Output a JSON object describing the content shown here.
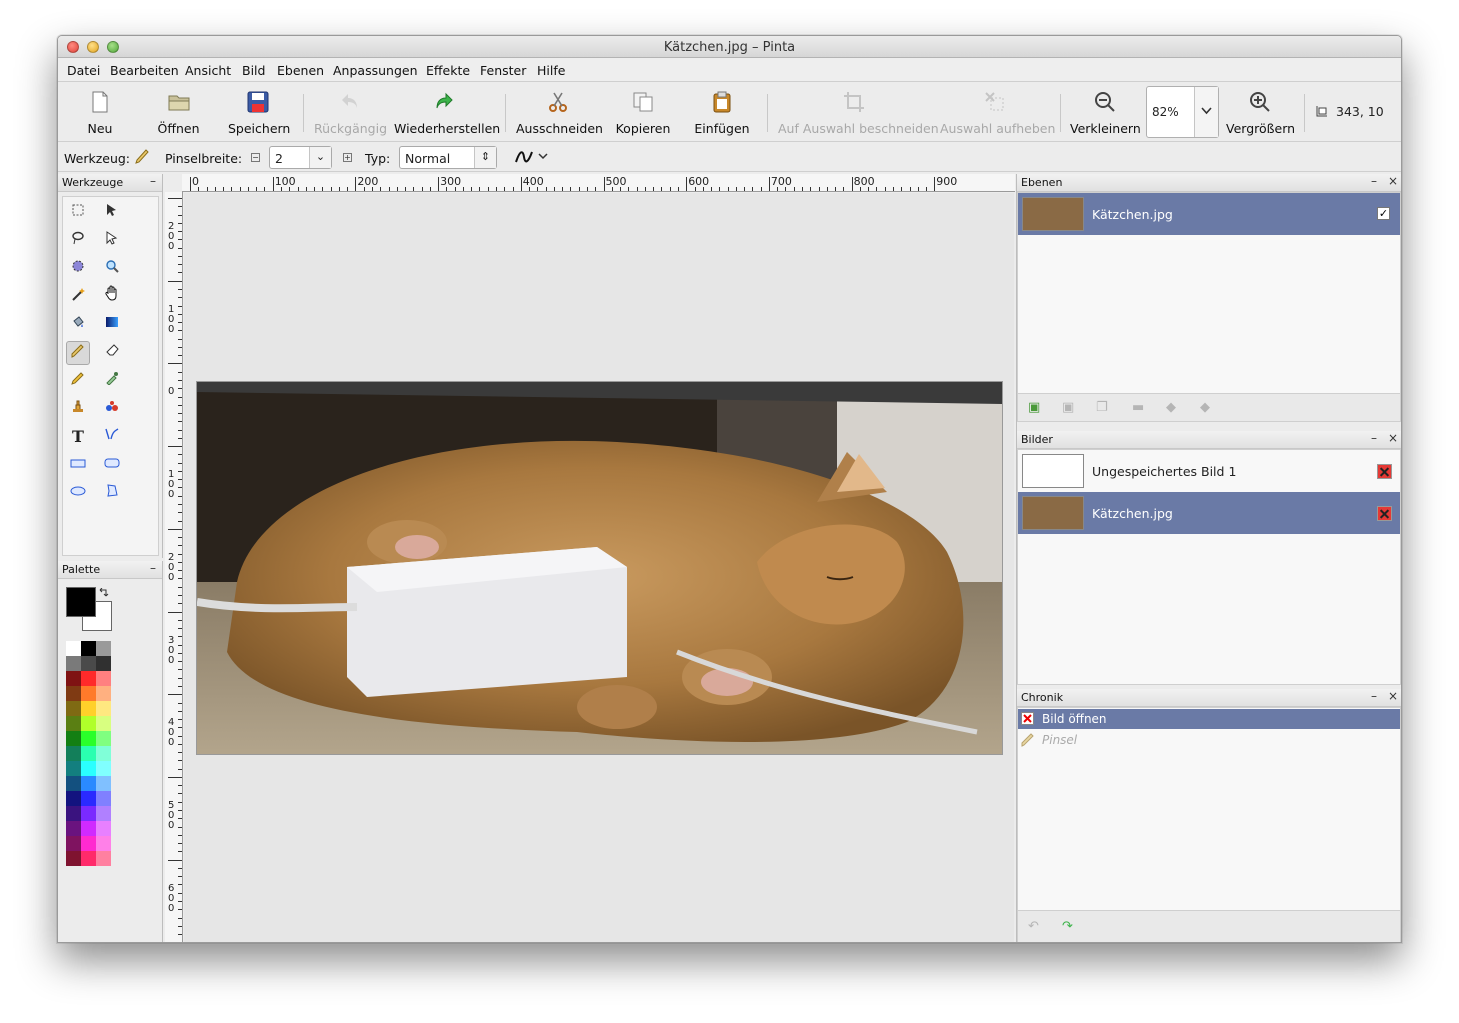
{
  "window": {
    "title": "Kätzchen.jpg – Pinta"
  },
  "menu": [
    "Datei",
    "Bearbeiten",
    "Ansicht",
    "Bild",
    "Ebenen",
    "Anpassungen",
    "Effekte",
    "Fenster",
    "Hilfe"
  ],
  "toolbar": {
    "new": "Neu",
    "open": "Öffnen",
    "save": "Speichern",
    "undo": "Rückgängig",
    "redo": "Wiederherstellen",
    "cut": "Ausschneiden",
    "copy": "Kopieren",
    "paste": "Einfügen",
    "crop": "Auf Auswahl beschneiden",
    "deselect": "Auswahl aufheben",
    "zoom_out": "Verkleinern",
    "zoom_value": "82%",
    "zoom_in": "Vergrößern",
    "coords": "343, 10"
  },
  "options": {
    "tool_label": "Werkzeug:",
    "brush_width_label": "Pinselbreite:",
    "brush_width": "2",
    "type_label": "Typ:",
    "type_value": "Normal"
  },
  "panels": {
    "tools": "Werkzeuge",
    "palette": "Palette",
    "layers": "Ebenen",
    "images": "Bilder",
    "history": "Chronik"
  },
  "layers": [
    {
      "name": "Kätzchen.jpg",
      "visible": true
    }
  ],
  "images": [
    {
      "name": "Ungespeichertes Bild 1"
    },
    {
      "name": "Kätzchen.jpg"
    }
  ],
  "history": [
    {
      "name": "Bild öffnen"
    },
    {
      "name": "Pinsel"
    }
  ],
  "ruler_labels": [
    "0",
    "100",
    "200",
    "300",
    "400",
    "500",
    "600",
    "700",
    "800",
    "900"
  ],
  "ruler_v_labels": [
    "200",
    "100",
    "0",
    "100",
    "200",
    "300",
    "400",
    "500",
    "600"
  ],
  "colors": {
    "selection": "#6a7aa6",
    "primary": "#000000",
    "secondary": "#ffffff"
  }
}
